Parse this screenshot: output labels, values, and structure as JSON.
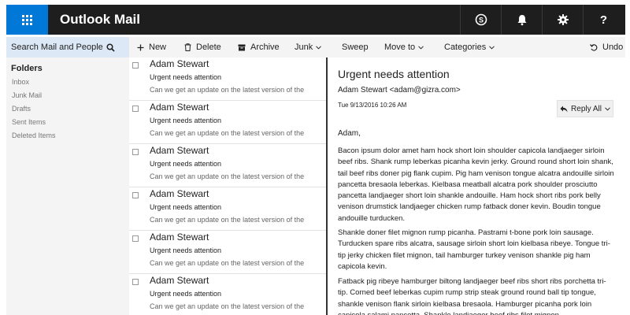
{
  "header": {
    "app_title": "Outlook Mail",
    "icons": [
      "waffle-icon",
      "skype-icon",
      "bell-icon",
      "gear-icon",
      "help-icon"
    ],
    "help_label": "?"
  },
  "search": {
    "label": "Search Mail and People",
    "icon": "search-icon"
  },
  "toolbar": {
    "new_label": "New",
    "delete_label": "Delete",
    "archive_label": "Archive",
    "junk_label": "Junk",
    "sweep_label": "Sweep",
    "move_label": "Move to",
    "categories_label": "Categories",
    "undo_label": "Undo"
  },
  "folders": {
    "heading": "Folders",
    "items": [
      "Inbox",
      "Junk Mail",
      "Drafts",
      "Sent Items",
      "Deleted Items"
    ]
  },
  "messages": [
    {
      "from": "Adam Stewart",
      "subject": "Urgent needs attention",
      "preview": "Can we get an update on the latest version of the"
    },
    {
      "from": "Adam Stewart",
      "subject": "Urgent needs attention",
      "preview": "Can we get an update on the latest version of the"
    },
    {
      "from": "Adam Stewart",
      "subject": "Urgent needs attention",
      "preview": "Can we get an update on the latest version of the"
    },
    {
      "from": "Adam Stewart",
      "subject": "Urgent needs attention",
      "preview": "Can we get an update on the latest version of the"
    },
    {
      "from": "Adam Stewart",
      "subject": "Urgent needs attention",
      "preview": "Can we get an update on the latest version of the"
    },
    {
      "from": "Adam Stewart",
      "subject": "Urgent needs attention",
      "preview": "Can we get an update on the latest version of the"
    }
  ],
  "reading": {
    "subject": "Urgent needs attention",
    "sender": "Adam Stewart <adam@gizra.com>",
    "date": "Tue 9/13/2016 10:26 AM",
    "reply_label": "Reply All",
    "greeting": "Adam,",
    "paragraphs": [
      "Bacon ipsum dolor amet ham hock short loin shoulder capicola landjaeger sirloin beef ribs. Shank rump leberkas picanha kevin jerky. Ground round short loin shank, tail beef ribs doner pig flank cupim. Pig ham venison tongue alcatra andouille sirloin pancetta bresaola leberkas. Kielbasa meatball alcatra pork shoulder prosciutto pancetta landjaeger short loin shankle andouille. Ham hock short ribs pork belly venison drumstick landjaeger chicken rump fatback doner kevin. Boudin tongue andouille turducken.",
      "Shankle doner filet mignon rump picanha. Pastrami t-bone pork loin sausage. Turducken spare ribs alcatra, sausage sirloin short loin kielbasa ribeye. Tongue tri-tip jerky chicken filet mignon, tail hamburger turkey venison shankle pig ham capicola kevin.",
      "Fatback pig ribeye hamburger biltong landjaeger beef ribs short ribs porchetta tri-tip. Corned beef leberkas cupim rump strip steak ground round ball tip tongue, shankle venison flank sirloin kielbasa bresaola. Hamburger picanha pork loin capicola salami pancetta. Shankle landjaeger beef ribs filet mignon."
    ]
  }
}
